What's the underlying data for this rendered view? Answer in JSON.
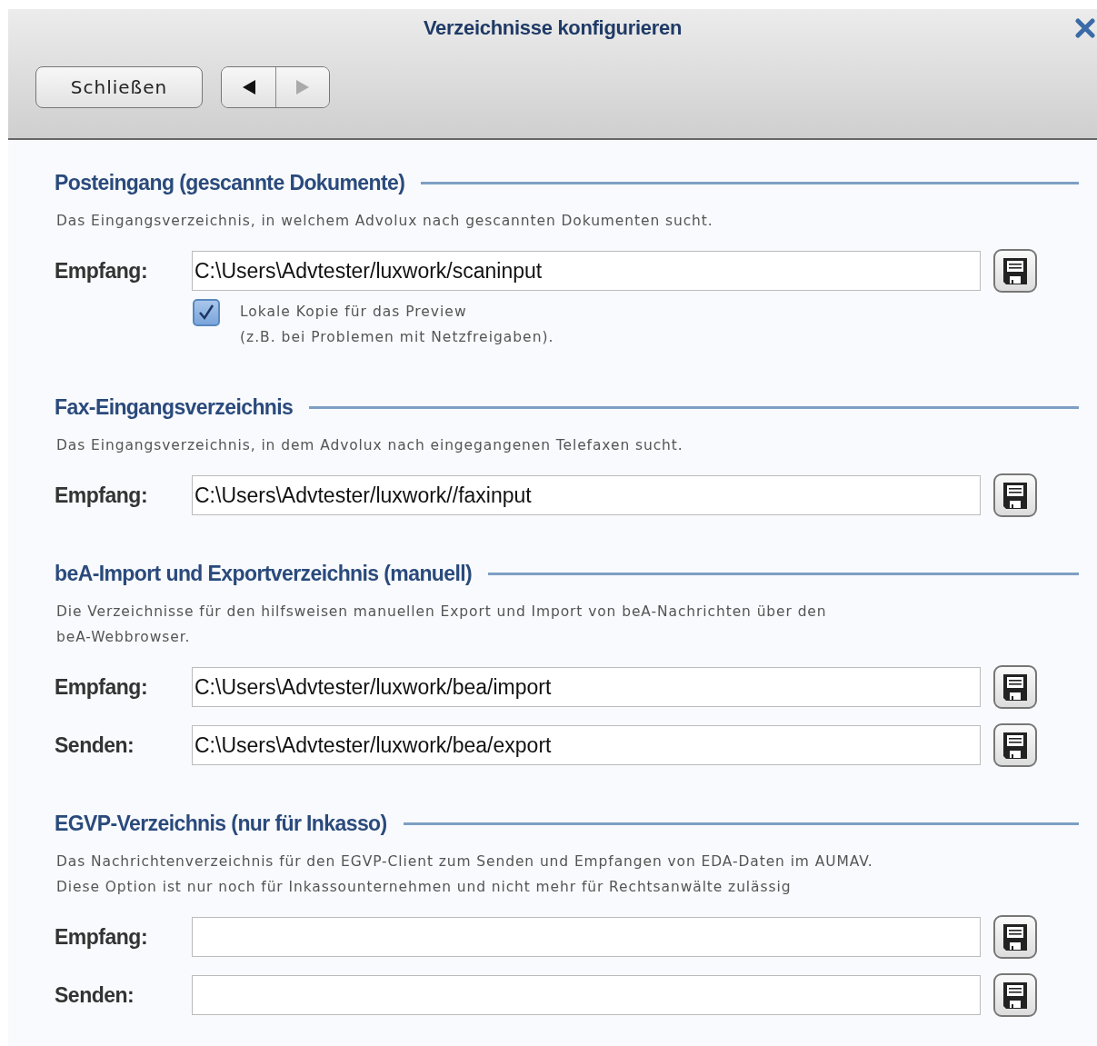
{
  "window": {
    "title": "Verzeichnisse konfigurieren"
  },
  "toolbar": {
    "close_button": "Schließen",
    "nav": [
      {
        "kind": "back",
        "disabled": false
      },
      {
        "kind": "forward",
        "disabled": true
      }
    ]
  },
  "sections": [
    {
      "title": "Posteingang (gescannte Dokumente)",
      "description_lines": [
        "Das Eingangsverzeichnis, in welchem Advolux nach gescannten Dokumenten sucht."
      ],
      "fields": [
        {
          "label": "Empfang:",
          "value": "C:\\Users\\Advtester/luxwork/scaninput"
        }
      ],
      "checkbox": {
        "checked": true,
        "lines": [
          "Lokale Kopie für das Preview",
          "(z.B. bei Problemen mit Netzfreigaben)."
        ]
      }
    },
    {
      "title": "Fax-Eingangsverzeichnis",
      "description_lines": [
        "Das Eingangsverzeichnis, in dem Advolux nach eingegangenen Telefaxen sucht."
      ],
      "fields": [
        {
          "label": "Empfang:",
          "value": "C:\\Users\\Advtester/luxwork//faxinput"
        }
      ]
    },
    {
      "title": "beA-Import und Exportverzeichnis (manuell)",
      "description_lines": [
        "Die Verzeichnisse für den hilfsweisen manuellen Export und Import von beA-Nachrichten über den",
        "beA-Webbrowser."
      ],
      "fields": [
        {
          "label": "Empfang:",
          "value": "C:\\Users\\Advtester/luxwork/bea/import"
        },
        {
          "label": "Senden:",
          "value": "C:\\Users\\Advtester/luxwork/bea/export"
        }
      ]
    },
    {
      "title": "EGVP-Verzeichnis (nur für Inkasso)",
      "description_lines": [
        "Das Nachrichtenverzeichnis für den EGVP-Client zum Senden und Empfangen von EDA-Daten im AUMAV.",
        "Diese Option ist nur noch für Inkassounternehmen und nicht mehr für Rechtsanwälte zulässig"
      ],
      "fields": [
        {
          "label": "Empfang:"
        },
        {
          "label": "Senden:"
        }
      ]
    }
  ]
}
